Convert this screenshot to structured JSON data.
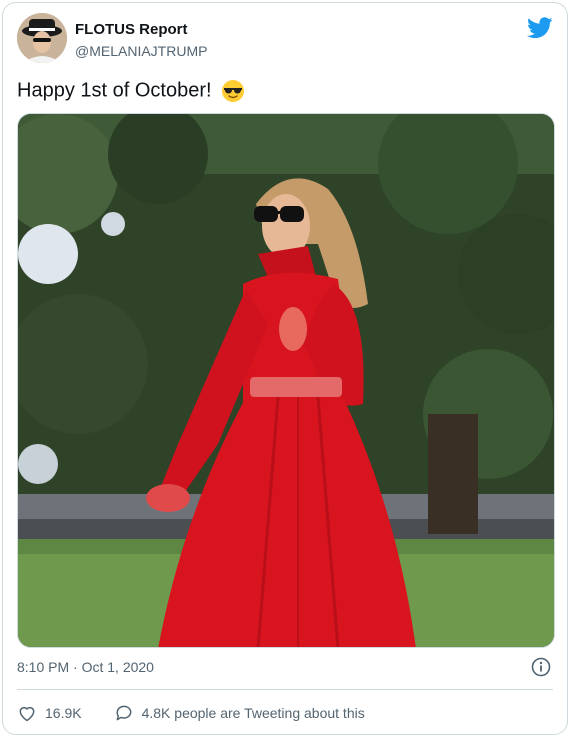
{
  "tweet": {
    "author_name": "FLOTUS Report",
    "author_handle": "@MELANIAJTRUMP",
    "text": "Happy 1st of October!",
    "emoji": "smiling-face-with-sunglasses",
    "timestamp": "8:10 PM · Oct 1, 2020",
    "like_count": "16.9K",
    "tweeting_text": "4.8K people are Tweeting about this"
  },
  "icons": {
    "brand": "twitter-bird-icon",
    "like": "heart-icon",
    "reply": "speech-bubble-icon",
    "info": "info-icon"
  },
  "colors": {
    "twitter_blue": "#1d9bf0",
    "coat_red": "#d8141f",
    "text_secondary": "#536471"
  }
}
